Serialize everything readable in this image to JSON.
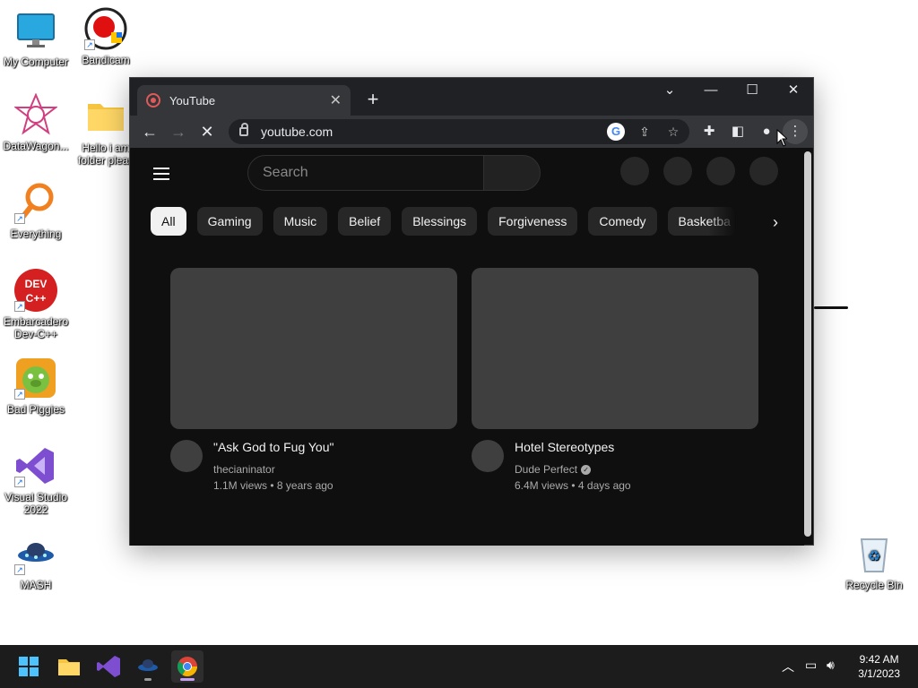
{
  "desktop": {
    "icons": [
      {
        "label": "My Computer",
        "icon": "monitor-icon"
      },
      {
        "label": "Bandicam",
        "icon": "bandicam-icon"
      },
      {
        "label": "DataWagon...",
        "icon": "datawagon-icon"
      },
      {
        "label": "Hello i am folder pleas",
        "icon": "folder-icon"
      },
      {
        "label": "Everything",
        "icon": "magnifier-icon"
      },
      {
        "label": "Embarcadero Dev-C++",
        "icon": "devcpp-icon"
      },
      {
        "label": "Bad Piggies",
        "icon": "pig-icon"
      },
      {
        "label": "Visual Studio 2022",
        "icon": "visual-studio-icon"
      },
      {
        "label": "MASH",
        "icon": "ufo-icon"
      },
      {
        "label": "Recycle Bin",
        "icon": "recycle-bin-icon"
      }
    ],
    "devcpp_badge": "DEV C++"
  },
  "browser": {
    "tab_title": "YouTube",
    "tab_close": "✕",
    "new_tab": "+",
    "url": "youtube.com",
    "google_letter": "G"
  },
  "youtube": {
    "search_placeholder": "Search",
    "chips": [
      "All",
      "Gaming",
      "Music",
      "Belief",
      "Blessings",
      "Forgiveness",
      "Comedy",
      "Basketba"
    ],
    "videos": [
      {
        "title": "\"Ask God to Fug You\"",
        "channel": "thecianinator",
        "views": "1.1M views • 8 years ago",
        "verified": false
      },
      {
        "title": "Hotel Stereotypes",
        "channel": "Dude Perfect",
        "views": "6.4M views • 4 days ago",
        "verified": true
      }
    ]
  },
  "taskbar": {
    "time": "9:42 AM",
    "date": "3/1/2023"
  },
  "colors": {
    "youtube_bg": "#0f0f0f",
    "chrome_toolbar": "#35363a",
    "chrome_titlebar": "#202124",
    "taskbar_bg": "#1c1c1c"
  }
}
